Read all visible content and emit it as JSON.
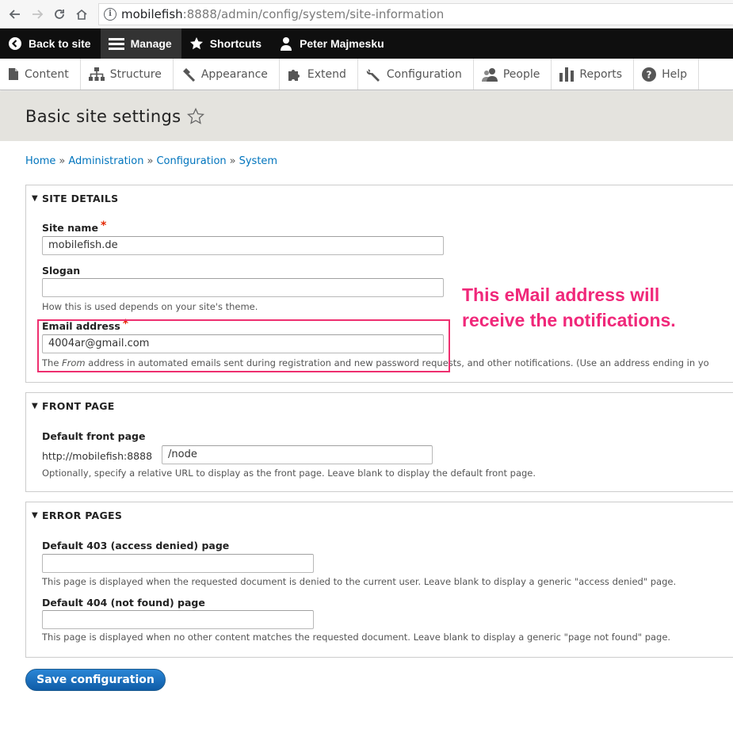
{
  "browser": {
    "url_host": "mobilefish",
    "url_path": ":8888/admin/config/system/site-information"
  },
  "admin_bar": {
    "back_label": "Back to site",
    "manage_label": "Manage",
    "shortcuts_label": "Shortcuts",
    "user_label": "Peter Majmesku"
  },
  "tray": {
    "items": [
      {
        "label": "Content",
        "icon": "page-icon"
      },
      {
        "label": "Structure",
        "icon": "sitemap-icon"
      },
      {
        "label": "Appearance",
        "icon": "brush-icon"
      },
      {
        "label": "Extend",
        "icon": "puzzle-icon"
      },
      {
        "label": "Configuration",
        "icon": "wrench-icon"
      },
      {
        "label": "People",
        "icon": "people-icon"
      },
      {
        "label": "Reports",
        "icon": "bar-chart-icon"
      },
      {
        "label": "Help",
        "icon": "help-icon"
      }
    ]
  },
  "page": {
    "title": "Basic site settings"
  },
  "breadcrumb": [
    "Home",
    "Administration",
    "Configuration",
    "System"
  ],
  "site_details": {
    "legend": "SITE DETAILS",
    "site_name_label": "Site name",
    "site_name_value": "mobilefish.de",
    "slogan_label": "Slogan",
    "slogan_value": "",
    "slogan_desc": "How this is used depends on your site's theme.",
    "email_label": "Email address",
    "email_value": "4004ar@gmail.com",
    "email_desc_pre": "The ",
    "email_desc_em": "From",
    "email_desc_post": " address in automated emails sent during registration and new password requests, and other notifications. (Use an address ending in yo"
  },
  "annotation": {
    "line1": "This eMail address will",
    "line2": "receive the notifications."
  },
  "front_page": {
    "legend": "FRONT PAGE",
    "label": "Default front page",
    "prefix": "http://mobilefish:8888",
    "value": "/node",
    "desc": "Optionally, specify a relative URL to display as the front page. Leave blank to display the default front page."
  },
  "error_pages": {
    "legend": "ERROR PAGES",
    "label_403": "Default 403 (access denied) page",
    "value_403": "",
    "desc_403": "This page is displayed when the requested document is denied to the current user. Leave blank to display a generic \"access denied\" page.",
    "label_404": "Default 404 (not found) page",
    "value_404": "",
    "desc_404": "This page is displayed when no other content matches the requested document. Leave blank to display a generic \"page not found\" page."
  },
  "actions": {
    "save_label": "Save configuration"
  },
  "colors": {
    "link": "#0074bd",
    "required": "#e32700",
    "annotation": "#f0287a",
    "button": "#1a6fc2",
    "toolbar": "#0f0f0f",
    "header_bg": "#e4e3de"
  }
}
